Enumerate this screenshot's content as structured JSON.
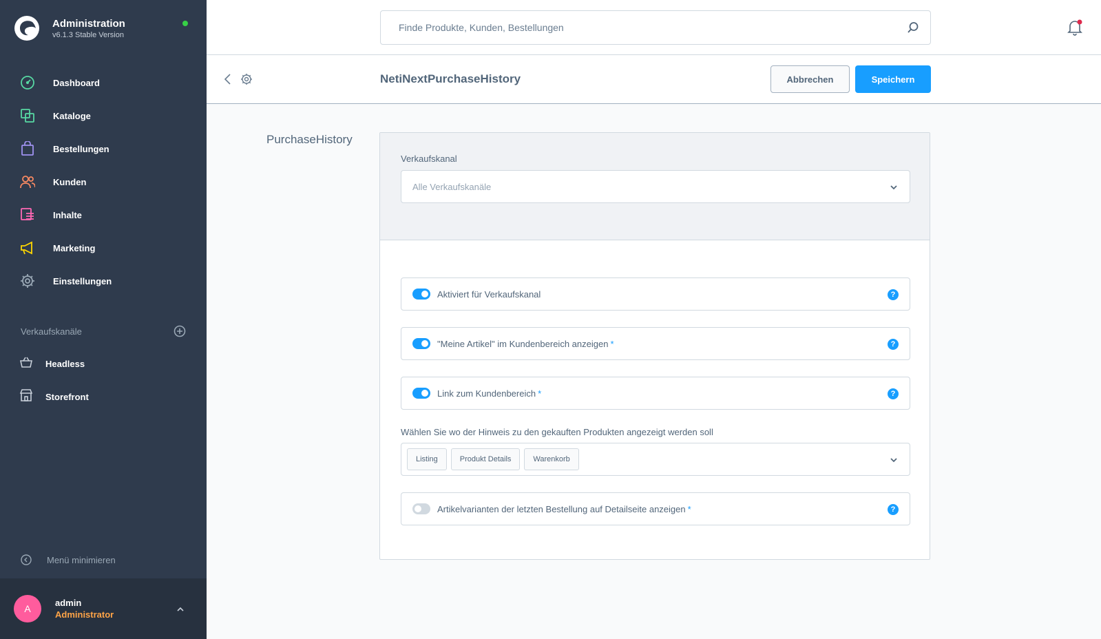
{
  "app": {
    "title": "Administration",
    "version": "v6.1.3 Stable Version"
  },
  "nav": {
    "items": [
      {
        "label": "Dashboard",
        "icon": "dashboard-icon",
        "color": "#57d9a3"
      },
      {
        "label": "Kataloge",
        "icon": "catalog-icon",
        "color": "#57d9a3"
      },
      {
        "label": "Bestellungen",
        "icon": "shopping-bag-icon",
        "color": "#a092f0"
      },
      {
        "label": "Kunden",
        "icon": "customers-icon",
        "color": "#f88962"
      },
      {
        "label": "Inhalte",
        "icon": "content-icon",
        "color": "#ff68b4"
      },
      {
        "label": "Marketing",
        "icon": "megaphone-icon",
        "color": "#ffd700"
      },
      {
        "label": "Einstellungen",
        "icon": "gear-icon",
        "color": "#9aa8b5"
      }
    ],
    "sales_channels_title": "Verkaufskanäle",
    "channels": [
      {
        "label": "Headless",
        "icon": "basket-icon"
      },
      {
        "label": "Storefront",
        "icon": "storefront-icon"
      }
    ],
    "minimize_label": "Menü minimieren"
  },
  "user": {
    "initial": "A",
    "name": "admin",
    "role": "Administrator"
  },
  "header": {
    "search_placeholder": "Finde Produkte, Kunden, Bestellungen"
  },
  "smartbar": {
    "title": "NetiNextPurchaseHistory",
    "cancel_label": "Abbrechen",
    "save_label": "Speichern"
  },
  "config": {
    "section_title": "PurchaseHistory",
    "sales_channel_label": "Verkaufskanal",
    "sales_channel_placeholder": "Alle Verkaufskanäle",
    "switches": [
      {
        "label": "Aktiviert für Verkaufskanal",
        "checked": true,
        "required": false
      },
      {
        "label": "\"Meine Artikel\" im Kundenbereich anzeigen",
        "checked": true,
        "required": true
      },
      {
        "label": "Link zum Kundenbereich",
        "checked": true,
        "required": true
      }
    ],
    "position_label": "Wählen Sie wo der Hinweis zu den gekauften Produkten angezeigt werden soll",
    "position_tags": [
      "Listing",
      "Produkt Details",
      "Warenkorb"
    ],
    "variants_switch": {
      "label": "Artikelvarianten der letzten Bestellung auf Detailseite anzeigen",
      "checked": false,
      "required": true
    },
    "required_marker": "*",
    "help_marker": "?"
  },
  "colors": {
    "sidebar_bg": "#2f3b4d",
    "accent": "#189eff",
    "status_online": "#37d046"
  }
}
